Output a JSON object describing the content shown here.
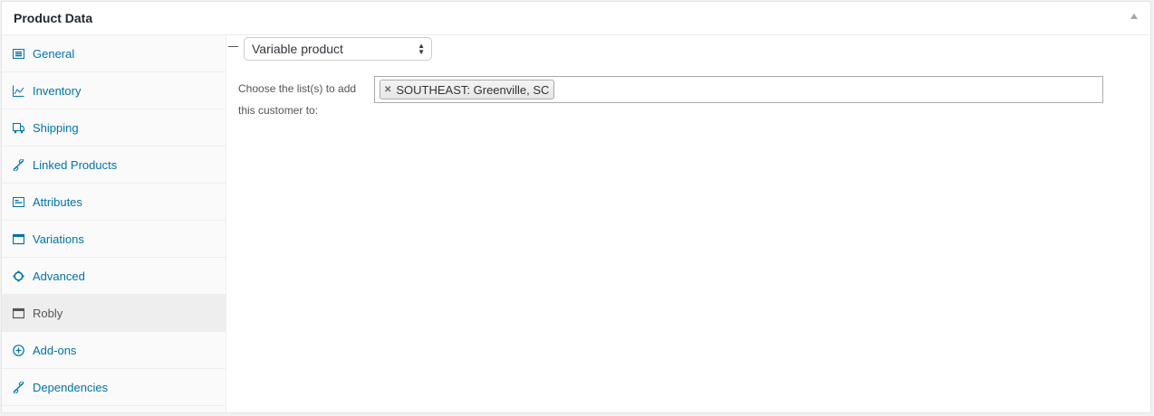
{
  "panel": {
    "title": "Product Data"
  },
  "tabs": [
    {
      "label": "General",
      "icon": "general-icon"
    },
    {
      "label": "Inventory",
      "icon": "inventory-icon"
    },
    {
      "label": "Shipping",
      "icon": "shipping-icon"
    },
    {
      "label": "Linked Products",
      "icon": "link-icon"
    },
    {
      "label": "Attributes",
      "icon": "attributes-icon"
    },
    {
      "label": "Variations",
      "icon": "variations-icon"
    },
    {
      "label": "Advanced",
      "icon": "gear-icon"
    },
    {
      "label": "Robly",
      "icon": "window-icon",
      "active": true
    },
    {
      "label": "Add-ons",
      "icon": "plus-circle-icon"
    },
    {
      "label": "Dependencies",
      "icon": "link-icon"
    }
  ],
  "product_type": {
    "selected": "Variable product"
  },
  "robly": {
    "lists_label": "Choose the list(s) to add this customer to:",
    "selected_lists": [
      "SOUTHEAST: Greenville, SC"
    ]
  },
  "colors": {
    "link": "#0073aa",
    "active_tab_bg": "#eeeeee"
  }
}
